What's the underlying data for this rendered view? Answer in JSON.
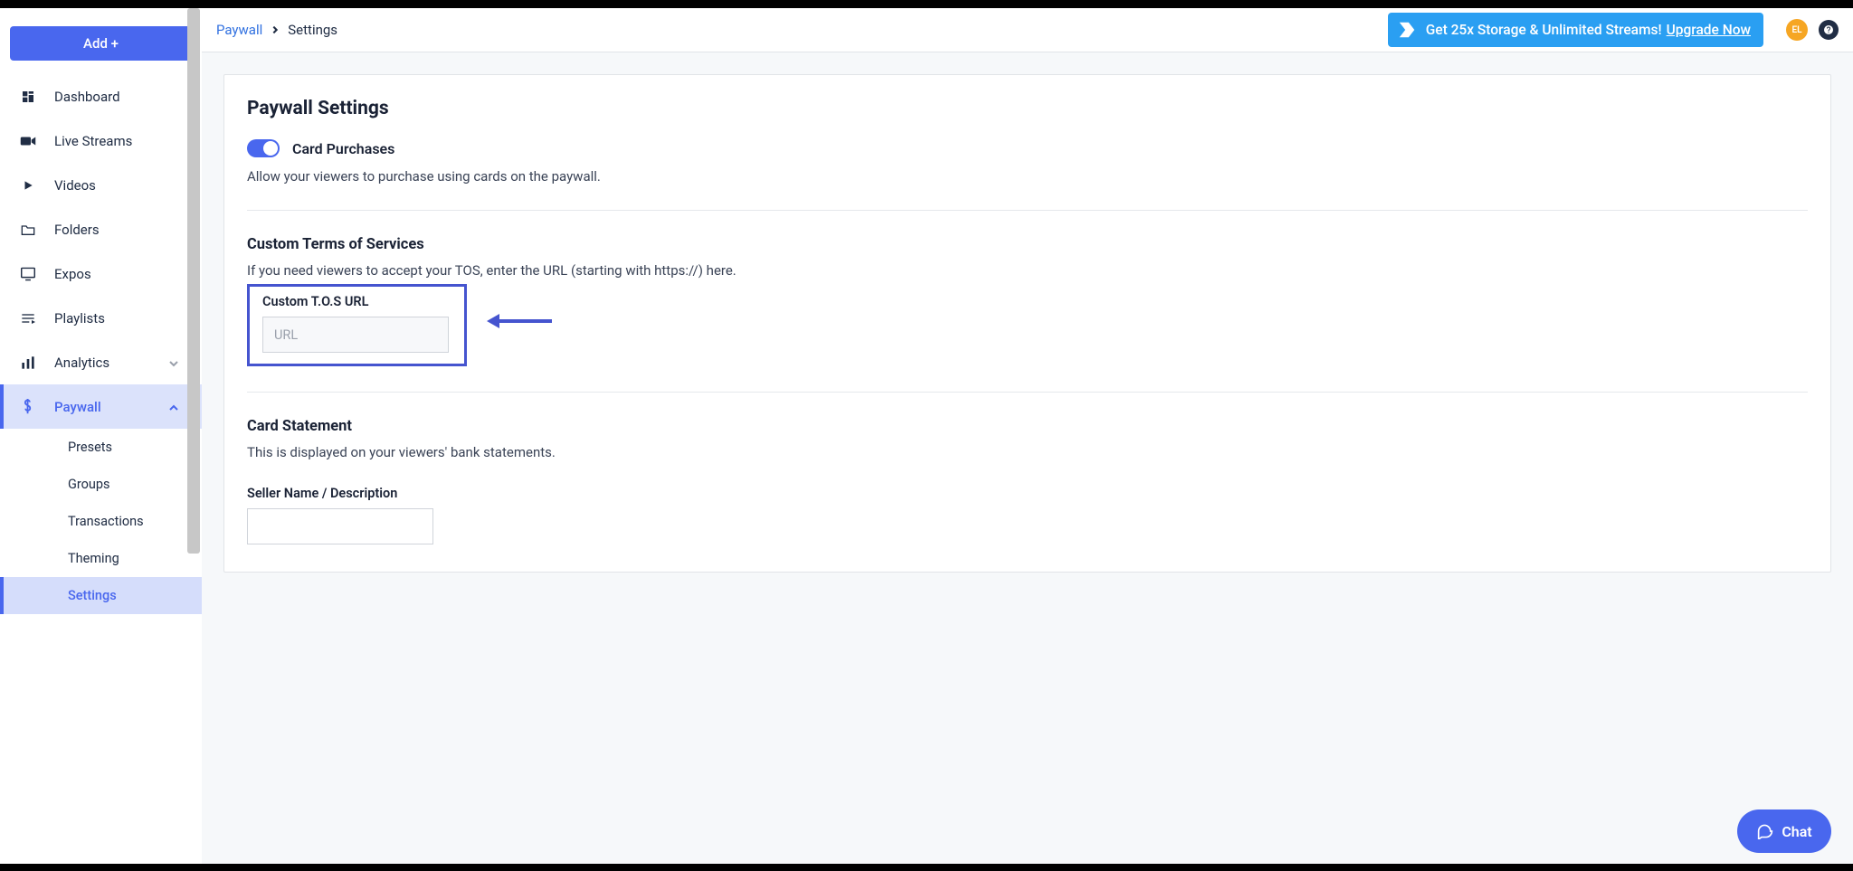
{
  "add_button_label": "Add +",
  "sidebar": {
    "items": [
      {
        "label": "Dashboard"
      },
      {
        "label": "Live Streams"
      },
      {
        "label": "Videos"
      },
      {
        "label": "Folders"
      },
      {
        "label": "Expos"
      },
      {
        "label": "Playlists"
      },
      {
        "label": "Analytics"
      },
      {
        "label": "Paywall"
      }
    ],
    "paywall_subs": [
      {
        "label": "Presets"
      },
      {
        "label": "Groups"
      },
      {
        "label": "Transactions"
      },
      {
        "label": "Theming"
      },
      {
        "label": "Settings"
      }
    ]
  },
  "breadcrumb": {
    "root": "Paywall",
    "current": "Settings"
  },
  "promo": {
    "text": "Get 25x Storage & Unlimited Streams! ",
    "cta": "Upgrade Now"
  },
  "avatar_initials": "EL",
  "page": {
    "title": "Paywall Settings",
    "card_purchases": {
      "label": "Card Purchases",
      "desc": "Allow your viewers to purchase using cards on the paywall."
    },
    "tos": {
      "title": "Custom Terms of Services",
      "desc": "If you need viewers to accept your TOS, enter the URL (starting with https://) here.",
      "field_label": "Custom T.O.S URL",
      "placeholder": "URL"
    },
    "statement": {
      "title": "Card Statement",
      "desc": "This is displayed on your viewers' bank statements.",
      "field_label": "Seller Name / Description"
    }
  },
  "chat_label": "Chat"
}
